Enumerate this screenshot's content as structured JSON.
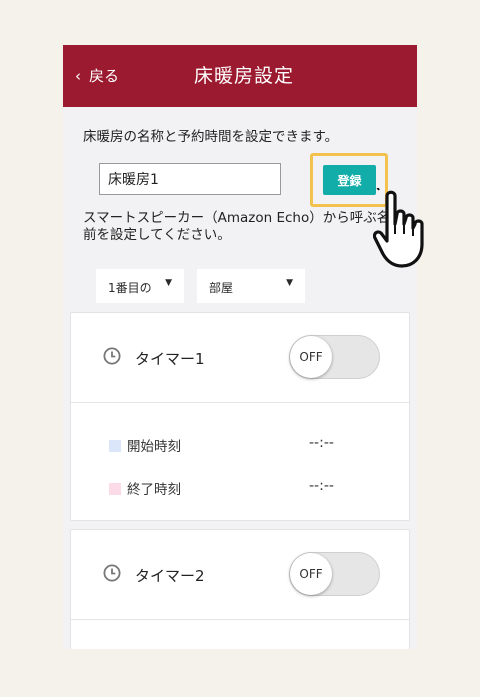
{
  "header": {
    "back_label": "戻る",
    "title": "床暖房設定"
  },
  "intro": {
    "description": "床暖房の名称と予約時間を設定できます。"
  },
  "name_form": {
    "value": "床暖房1",
    "register_label": "登録"
  },
  "speaker": {
    "description": "スマートスピーカー（Amazon Echo）から呼ぶ名前を設定してください。"
  },
  "selectors": {
    "order": "1番目の",
    "room": "部屋"
  },
  "timers": [
    {
      "name": "タイマー1",
      "toggle": "OFF",
      "start_label": "開始時刻",
      "start_value": "--:--",
      "end_label": "終了時刻",
      "end_value": "--:--"
    },
    {
      "name": "タイマー2",
      "toggle": "OFF"
    }
  ],
  "colors": {
    "header": "#9b1a2f",
    "accent": "#13ada9",
    "highlight": "#f2c14e",
    "start_marker": "#dbe6fb",
    "end_marker": "#fbdbe8"
  }
}
